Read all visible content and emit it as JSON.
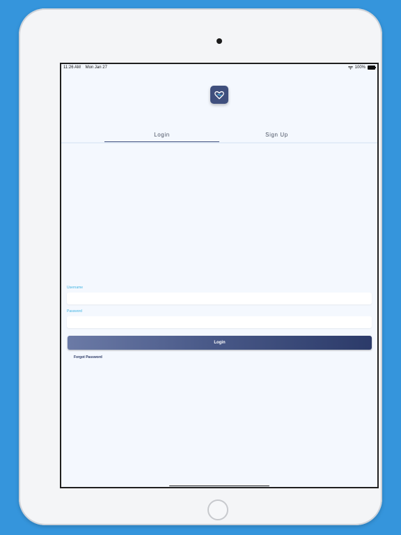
{
  "status_bar": {
    "time": "11:26 AM",
    "date": "Mon Jan 27",
    "battery": "100%",
    "battery_level": 1.0,
    "wifi_icon": "wifi-icon",
    "battery_icon": "battery-icon"
  },
  "app": {
    "logo_icon": "heart-logo-icon",
    "brand_color": "#3f4f7d",
    "accent_color": "#42b4e2"
  },
  "tabs": [
    {
      "label": "Login",
      "active": true
    },
    {
      "label": "Sign Up",
      "active": false
    }
  ],
  "form": {
    "username_label": "Username",
    "username_value": "",
    "password_label": "Password",
    "password_value": "",
    "submit_label": "Login",
    "forgot_label": "Forgot Password"
  }
}
